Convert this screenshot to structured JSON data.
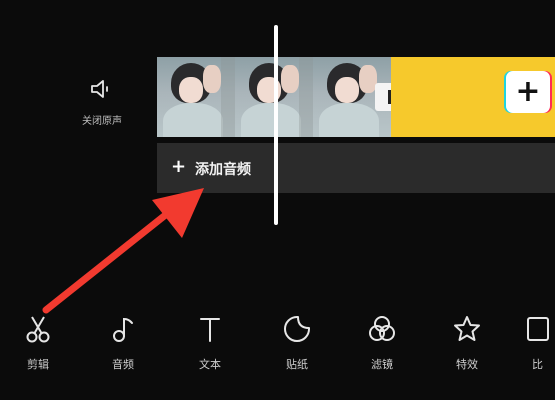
{
  "timeline": {
    "mute_label": "关闭原声",
    "add_audio_label": "添加音频"
  },
  "toolbar": {
    "items": [
      {
        "label": "剪辑",
        "icon": "scissors-icon"
      },
      {
        "label": "音频",
        "icon": "music-note-icon"
      },
      {
        "label": "文本",
        "icon": "text-icon"
      },
      {
        "label": "贴纸",
        "icon": "sticker-icon"
      },
      {
        "label": "滤镜",
        "icon": "filter-icon"
      },
      {
        "label": "特效",
        "icon": "effects-star-icon"
      },
      {
        "label": "比",
        "icon": "aspect-ratio-icon"
      }
    ]
  },
  "colors": {
    "accent_yellow": "#F6C92C",
    "arrow_red": "#F23A2F",
    "background": "#0B0B0B"
  }
}
